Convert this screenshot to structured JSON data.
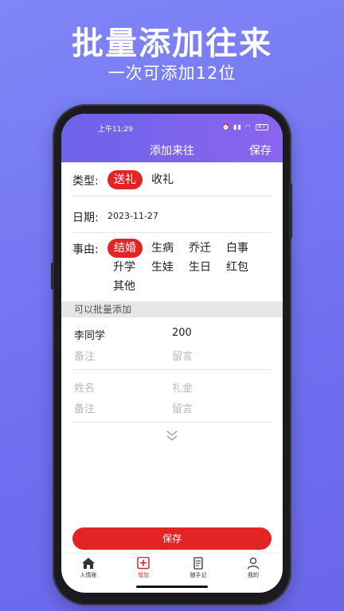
{
  "promo": {
    "title": "批量添加往来",
    "subtitle": "一次可添加12位"
  },
  "status_bar": {
    "time": "上午11:29",
    "battery": "87"
  },
  "header": {
    "title": "添加来往",
    "save_label": "保存"
  },
  "form": {
    "type": {
      "label": "类型:",
      "options": [
        "送礼",
        "收礼"
      ],
      "selected": "送礼"
    },
    "date": {
      "label": "日期:",
      "value": "2023-11-27"
    },
    "reason": {
      "label": "事由:",
      "options": [
        "结婚",
        "生病",
        "乔迁",
        "白事",
        "升学",
        "生娃",
        "生日",
        "红包",
        "其他"
      ],
      "selected": "结婚"
    }
  },
  "batch": {
    "hint": "可以批量添加",
    "entries": [
      {
        "name": "李同学",
        "amount": "200",
        "note_placeholder": "备注",
        "message_placeholder": "留言"
      },
      {
        "name_placeholder": "姓名",
        "amount_placeholder": "礼金",
        "note_placeholder": "备注",
        "message_placeholder": "留言"
      }
    ]
  },
  "save_button": "保存",
  "tabbar": {
    "items": [
      {
        "label": "人情账",
        "icon": "home-icon"
      },
      {
        "label": "增加",
        "icon": "add-box-icon"
      },
      {
        "label": "随手记",
        "icon": "notepad-icon"
      },
      {
        "label": "我的",
        "icon": "user-icon"
      }
    ],
    "active": "增加"
  },
  "colors": {
    "accent_red": "#e32424",
    "header_gradient_start": "#6c63e9",
    "header_gradient_end": "#8b64ef",
    "background": "#7a7cf4"
  }
}
